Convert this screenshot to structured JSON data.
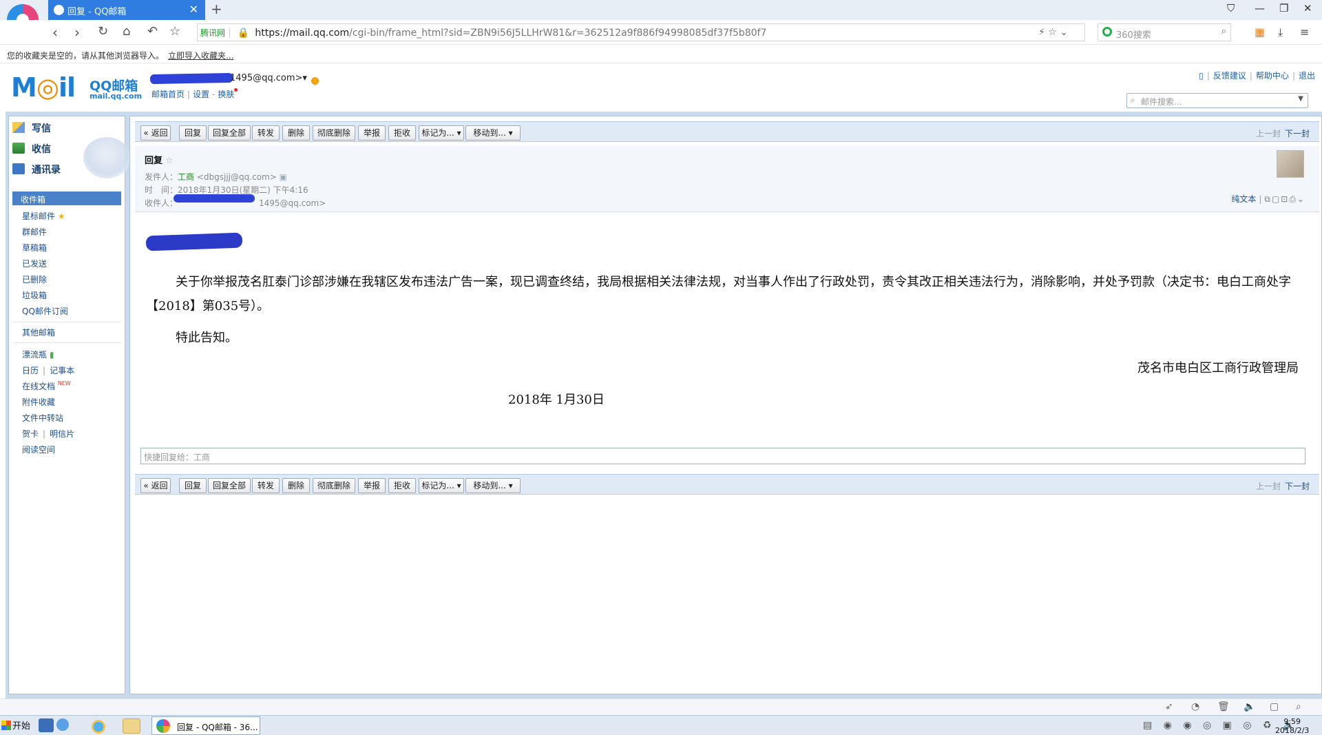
{
  "browser": {
    "tab_title": "回复 - QQ邮箱",
    "new_tab": "+",
    "address": {
      "tencent_badge": "腾讯网",
      "url_host": "https://mail.qq.com",
      "url_rest": "/cgi-bin/frame_html?sid=ZBN9i56J5LLHrW81&r=362512a9f886f94998085df37f5b80f7"
    },
    "search_placeholder": "360搜索",
    "favbar_text": "您的收藏夹是空的，请从其他浏览器导入。",
    "favbar_link": "立即导入收藏夹..."
  },
  "mail_header": {
    "logo_text": "M",
    "logo_text2": "il",
    "logo_qq": "QQ邮箱",
    "logo_domain": "mail.qq.com",
    "account": "1495@qq.com>",
    "links": [
      "邮箱首页",
      "设置",
      "换肤"
    ],
    "top_links": [
      "反馈建议",
      "帮助中心",
      "退出"
    ],
    "search_placeholder": "邮件搜索..."
  },
  "sidebar": {
    "write": "写信",
    "receive": "收信",
    "contacts": "通讯录",
    "inbox": "收件箱",
    "folders": [
      "星标邮件",
      "群邮件",
      "草稿箱",
      "已发送",
      "已删除",
      "垃圾箱",
      "QQ邮件订阅"
    ],
    "other": "其他邮箱",
    "apps": {
      "drift": "漂流瓶",
      "calendar": "日历",
      "notes": "记事本",
      "docs": "在线文档",
      "new_badge": "NEW",
      "attachments": "附件收藏",
      "transfer": "文件中转站",
      "cards": "贺卡",
      "postcards": "明信片",
      "reading": "阅读空间"
    }
  },
  "toolbar": {
    "back": "« 返回",
    "reply": "回复",
    "reply_all": "回复全部",
    "forward": "转发",
    "delete": "删除",
    "delete_perm": "彻底删除",
    "report": "举报",
    "reject": "拒收",
    "mark_as": "标记为... ▾",
    "move_to": "移动到... ▾",
    "prev": "上一封",
    "next": "下一封"
  },
  "message": {
    "subject": "回复",
    "sender_label": "发件人：",
    "sender_name": "工商",
    "sender_email": "<dbgsjjj@qq.com>",
    "time_label": "时　间：",
    "time_value": "2018年1月30日(星期二) 下午4:16",
    "rcpt_label": "收件人：",
    "rcpt_value": "1495@qq.com>",
    "plain_text": "纯文本",
    "para1": "关于你举报茂名肛泰门诊部涉嫌在我辖区发布违法广告一案，现已调查终结，我局根据相关法律法规，对当事人作出了行政处罚，责令其改正相关违法行为，消除影响，并处予罚款（决定书：电白工商处字【2018】第035号）。",
    "para2": "特此告知。",
    "signer": "茂名市电白区工商行政管理局",
    "sign_date": "2018年  1月30日",
    "quick_reply": "快捷回复给：工商"
  },
  "taskbar": {
    "start": "开始",
    "task_title": "回复 - QQ邮箱 - 36...",
    "time": "9:59",
    "date": "2018/2/3"
  }
}
